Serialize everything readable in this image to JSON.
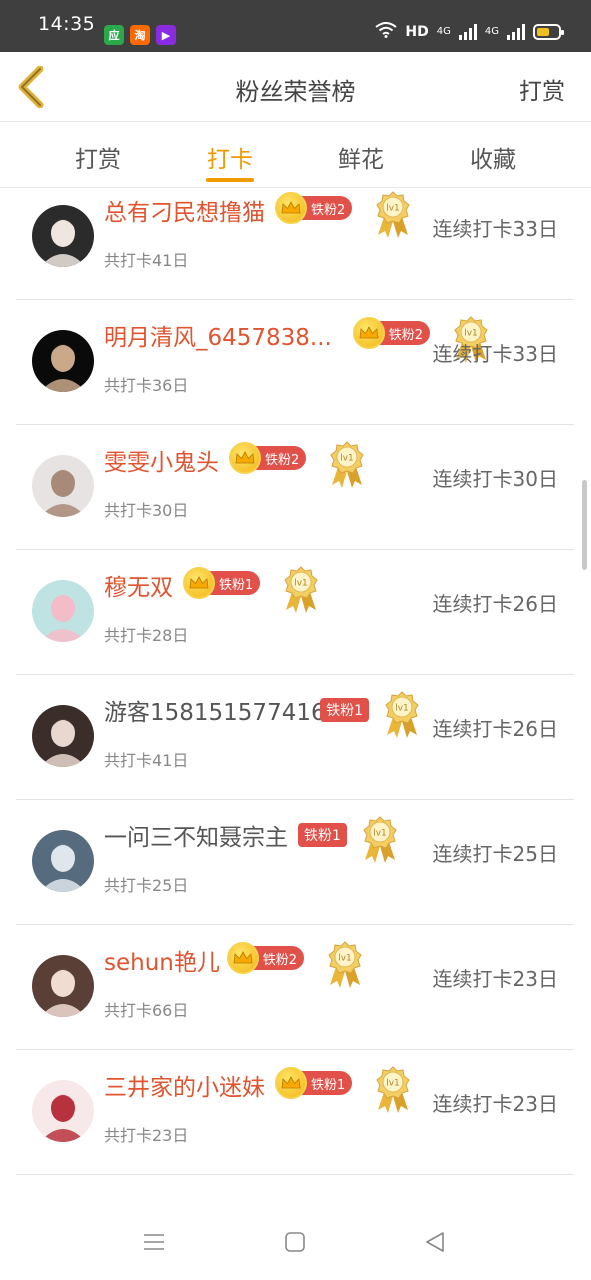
{
  "status_bar": {
    "time": "14:35",
    "network": "HD",
    "network_2": "4G",
    "network_3": "4G",
    "apps": [
      {
        "icon": "yingyongbao-icon",
        "color": "#2aa84a",
        "glyph": "应"
      },
      {
        "icon": "taobao-icon",
        "color": "#ff6a00",
        "glyph": "淘"
      },
      {
        "icon": "video-app-icon",
        "color": "#8a2be2",
        "glyph": "▶"
      }
    ],
    "battery_level": 0.6
  },
  "header": {
    "back_icon": "chevron-left-icon",
    "title": "粉丝荣誉榜",
    "right_link": "打赏"
  },
  "tabs": [
    {
      "label": "打赏",
      "active": false
    },
    {
      "label": "打卡",
      "active": true
    },
    {
      "label": "鲜花",
      "active": false
    },
    {
      "label": "收藏",
      "active": false
    }
  ],
  "colors": {
    "accent": "#f09a00",
    "vip_name": "#e0542f",
    "fan_badge": "#e2504a"
  },
  "fans": [
    {
      "name": "总有刁民想撸猫",
      "vip": true,
      "fan_level": "铁粉2",
      "medal": "lv1",
      "total": "共打卡41日",
      "streak": "连续打卡33日",
      "avatar": "avatar-girl-uniform",
      "avatar_bg": "#2b2b2b",
      "avatar_fg": "#efe6e1"
    },
    {
      "name": "明月清风_6457838...",
      "vip": true,
      "fan_level": "铁粉2",
      "medal": "lv1",
      "total": "共打卡36日",
      "streak": "连续打卡33日",
      "avatar": "avatar-dark-figure",
      "avatar_bg": "#0a0a0a",
      "avatar_fg": "#c9a98a"
    },
    {
      "name": "雯雯小鬼头",
      "vip": true,
      "fan_level": "铁粉2",
      "medal": "lv1",
      "total": "共打卡30日",
      "streak": "连续打卡30日",
      "avatar": "avatar-cat",
      "avatar_bg": "#e8e3e3",
      "avatar_fg": "#a88a78"
    },
    {
      "name": "穆无双",
      "vip": true,
      "fan_level": "铁粉1",
      "medal": "lv1",
      "total": "共打卡28日",
      "streak": "连续打卡26日",
      "avatar": "avatar-pink-hair",
      "avatar_bg": "#bfe3e2",
      "avatar_fg": "#f4bcc8"
    },
    {
      "name": "游客158151577416",
      "vip": false,
      "fan_level": "铁粉1",
      "medal": "lv1",
      "total": "共打卡41日",
      "streak": "连续打卡26日",
      "avatar": "avatar-costume",
      "avatar_bg": "#3b2d2a",
      "avatar_fg": "#e9d8cf"
    },
    {
      "name": "一问三不知聂宗主",
      "vip": false,
      "fan_level": "铁粉1",
      "medal": "lv1",
      "total": "共打卡25日",
      "streak": "连续打卡25日",
      "avatar": "avatar-swordsman",
      "avatar_bg": "#566b7d",
      "avatar_fg": "#dfe6ec"
    },
    {
      "name": "sehun艳儿",
      "vip": true,
      "fan_level": "铁粉2",
      "medal": "lv1",
      "total": "共打卡66日",
      "streak": "连续打卡23日",
      "avatar": "avatar-doll",
      "avatar_bg": "#5a3f36",
      "avatar_fg": "#f1dcd2"
    },
    {
      "name": "三井家的小迷妹",
      "vip": true,
      "fan_level": "铁粉1",
      "medal": "lv1",
      "total": "共打卡23日",
      "streak": "连续打卡23日",
      "avatar": "avatar-anime-girl",
      "avatar_bg": "#f7e9ea",
      "avatar_fg": "#b8323e"
    }
  ],
  "nav_bar": [
    "menu-icon",
    "home-square-icon",
    "back-triangle-icon"
  ]
}
